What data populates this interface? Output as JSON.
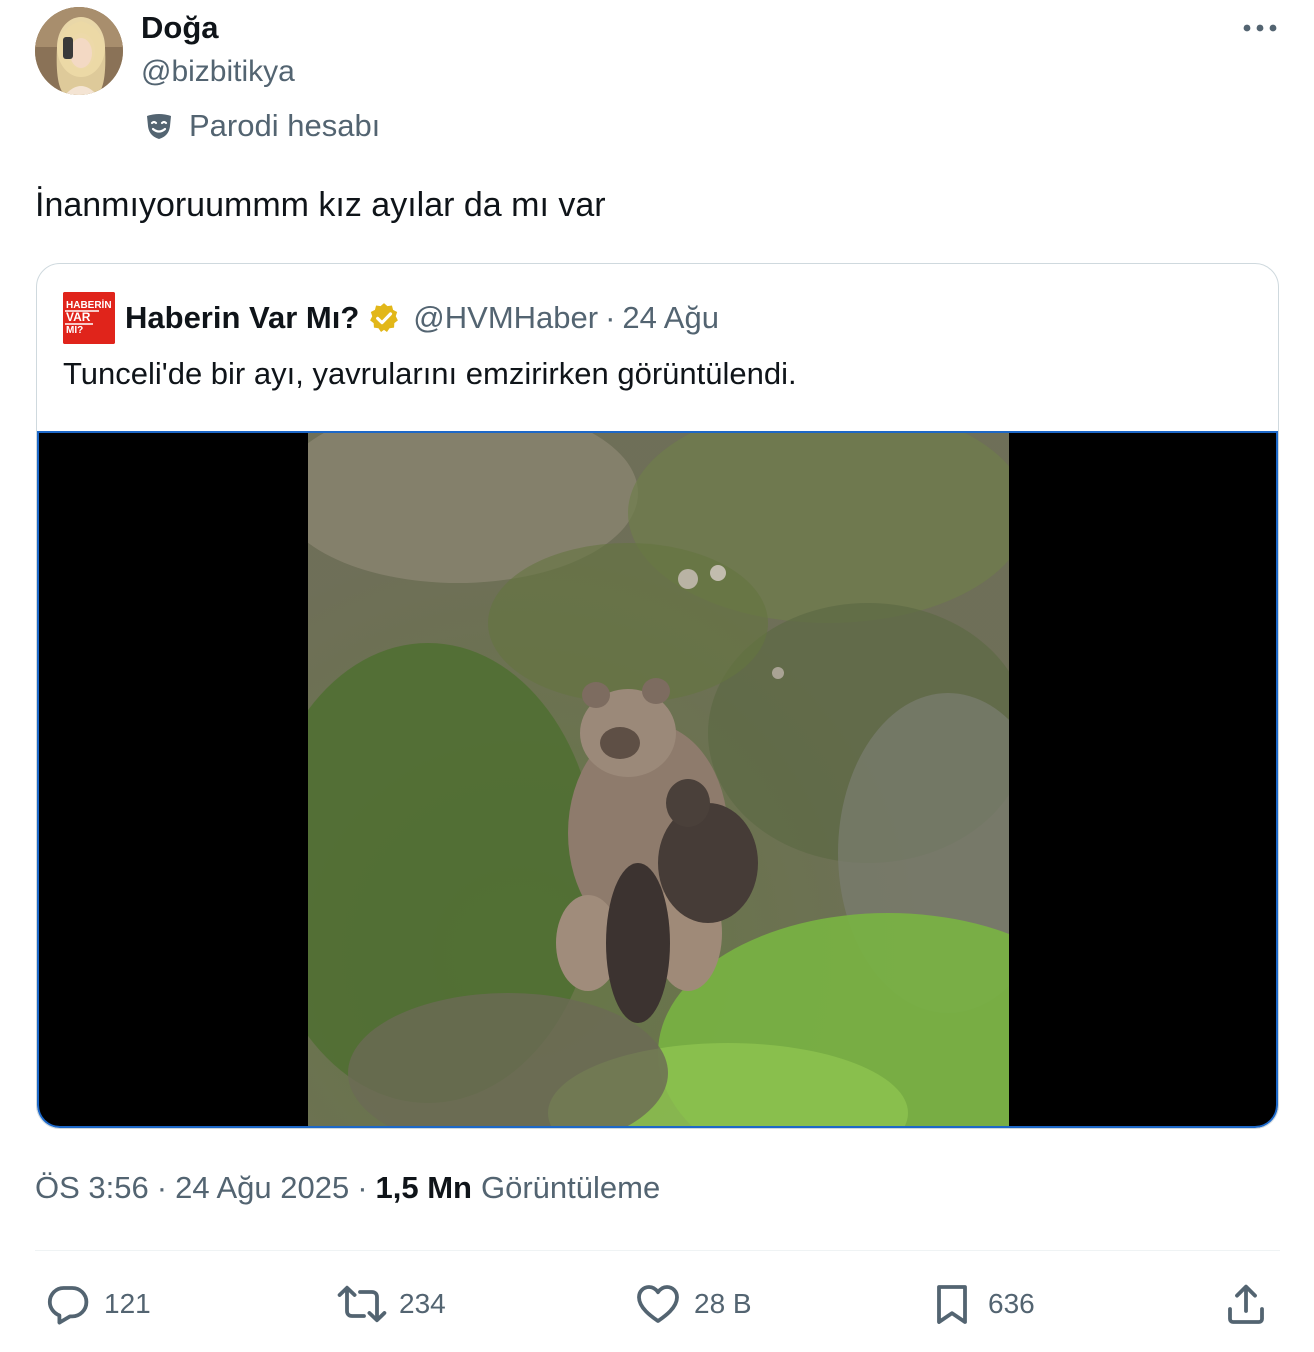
{
  "author": {
    "display_name": "Doğa",
    "handle": "@bizbitikya",
    "parody_label": "Parodi hesabı",
    "avatar_icon": "avatar-photo"
  },
  "tweet": {
    "text": "İnanmıyoruummm kız ayılar da mı var"
  },
  "quote": {
    "name": "Haberin Var Mı?",
    "handle": "@HVMHaber",
    "separator": "·",
    "date": "24 Ağu",
    "text": "Tunceli'de bir ayı, yavrularını emzirirken görüntülendi.",
    "logo_text": [
      "HABERİN",
      "VAR",
      "MI?"
    ],
    "badge_color": "#e2b719",
    "logo_color": "#e0241b"
  },
  "meta": {
    "time": "ÖS 3:56",
    "sep1": "·",
    "date": "24 Ağu 2025",
    "sep2": "·",
    "views_count": "1,5 Mn",
    "views_label": "Görüntüleme"
  },
  "actions": {
    "replies": "121",
    "reposts": "234",
    "likes": "28 B",
    "bookmarks": "636"
  },
  "colors": {
    "text_primary": "#0f1419",
    "text_secondary": "#536471",
    "border": "#cfd9de",
    "media_focus": "#1d68c8"
  }
}
